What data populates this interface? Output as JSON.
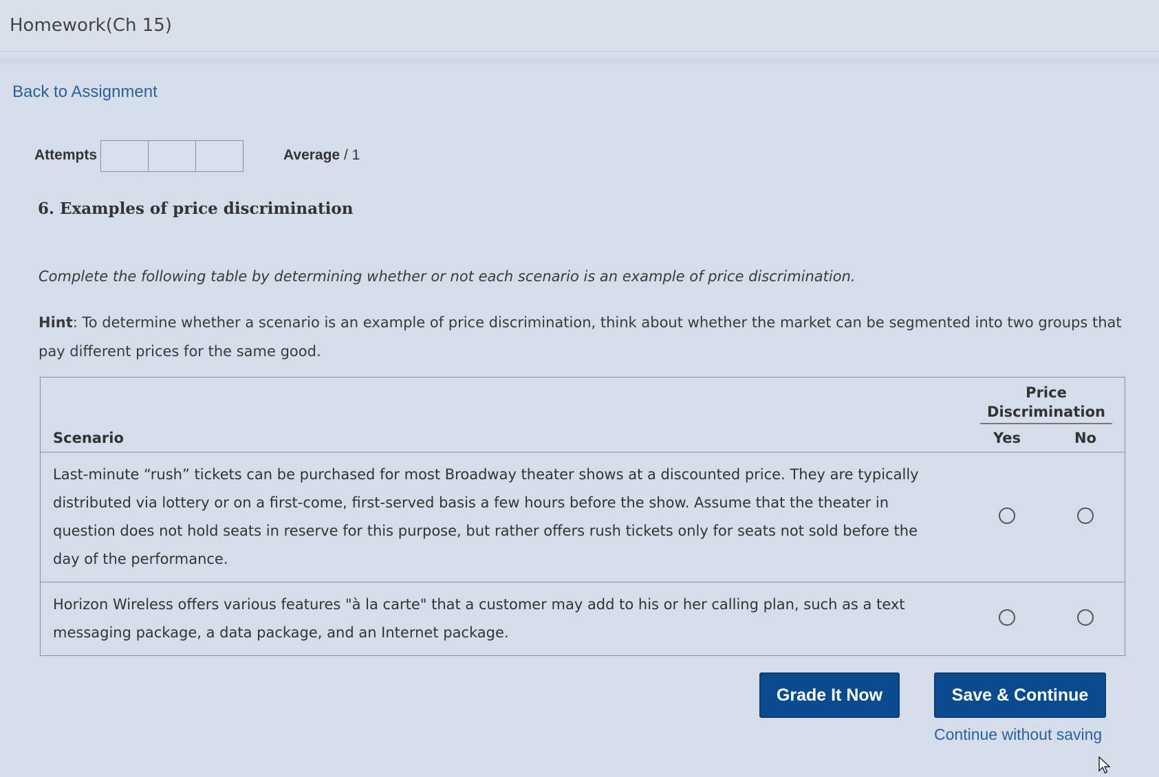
{
  "app": {
    "title": "Homework(Ch 15)"
  },
  "nav": {
    "back_label": "Back to Assignment"
  },
  "attempts": {
    "label": "Attempts",
    "average_label": "Average",
    "average_value": "/ 1"
  },
  "question": {
    "title": "6. Examples of price discrimination",
    "instructions": "Complete the following table by determining whether or not each scenario is an example of price discrimination.",
    "hint_label": "Hint",
    "hint_text": ": To determine whether a scenario is an example of price discrimination, think about whether the market can be segmented into two groups that pay different prices for the same good."
  },
  "table": {
    "col_scenario": "Scenario",
    "group_header": "Price Discrimination",
    "col_yes": "Yes",
    "col_no": "No",
    "rows": [
      {
        "scenario": "Last-minute “rush” tickets can be purchased for most Broadway theater shows at a discounted price. They are typically distributed via lottery or on a first-come, first-served basis a few hours before the show. Assume that the theater in question does not hold seats in reserve for this purpose, but rather offers rush tickets only for seats not sold before the day of the performance."
      },
      {
        "scenario": "Horizon Wireless offers various features \"à la carte\" that a customer may add to his or her calling plan, such as a text messaging package, a data package, and an Internet package."
      }
    ]
  },
  "actions": {
    "grade_label": "Grade It Now",
    "save_label": "Save & Continue",
    "continue_label": "Continue without saving"
  }
}
